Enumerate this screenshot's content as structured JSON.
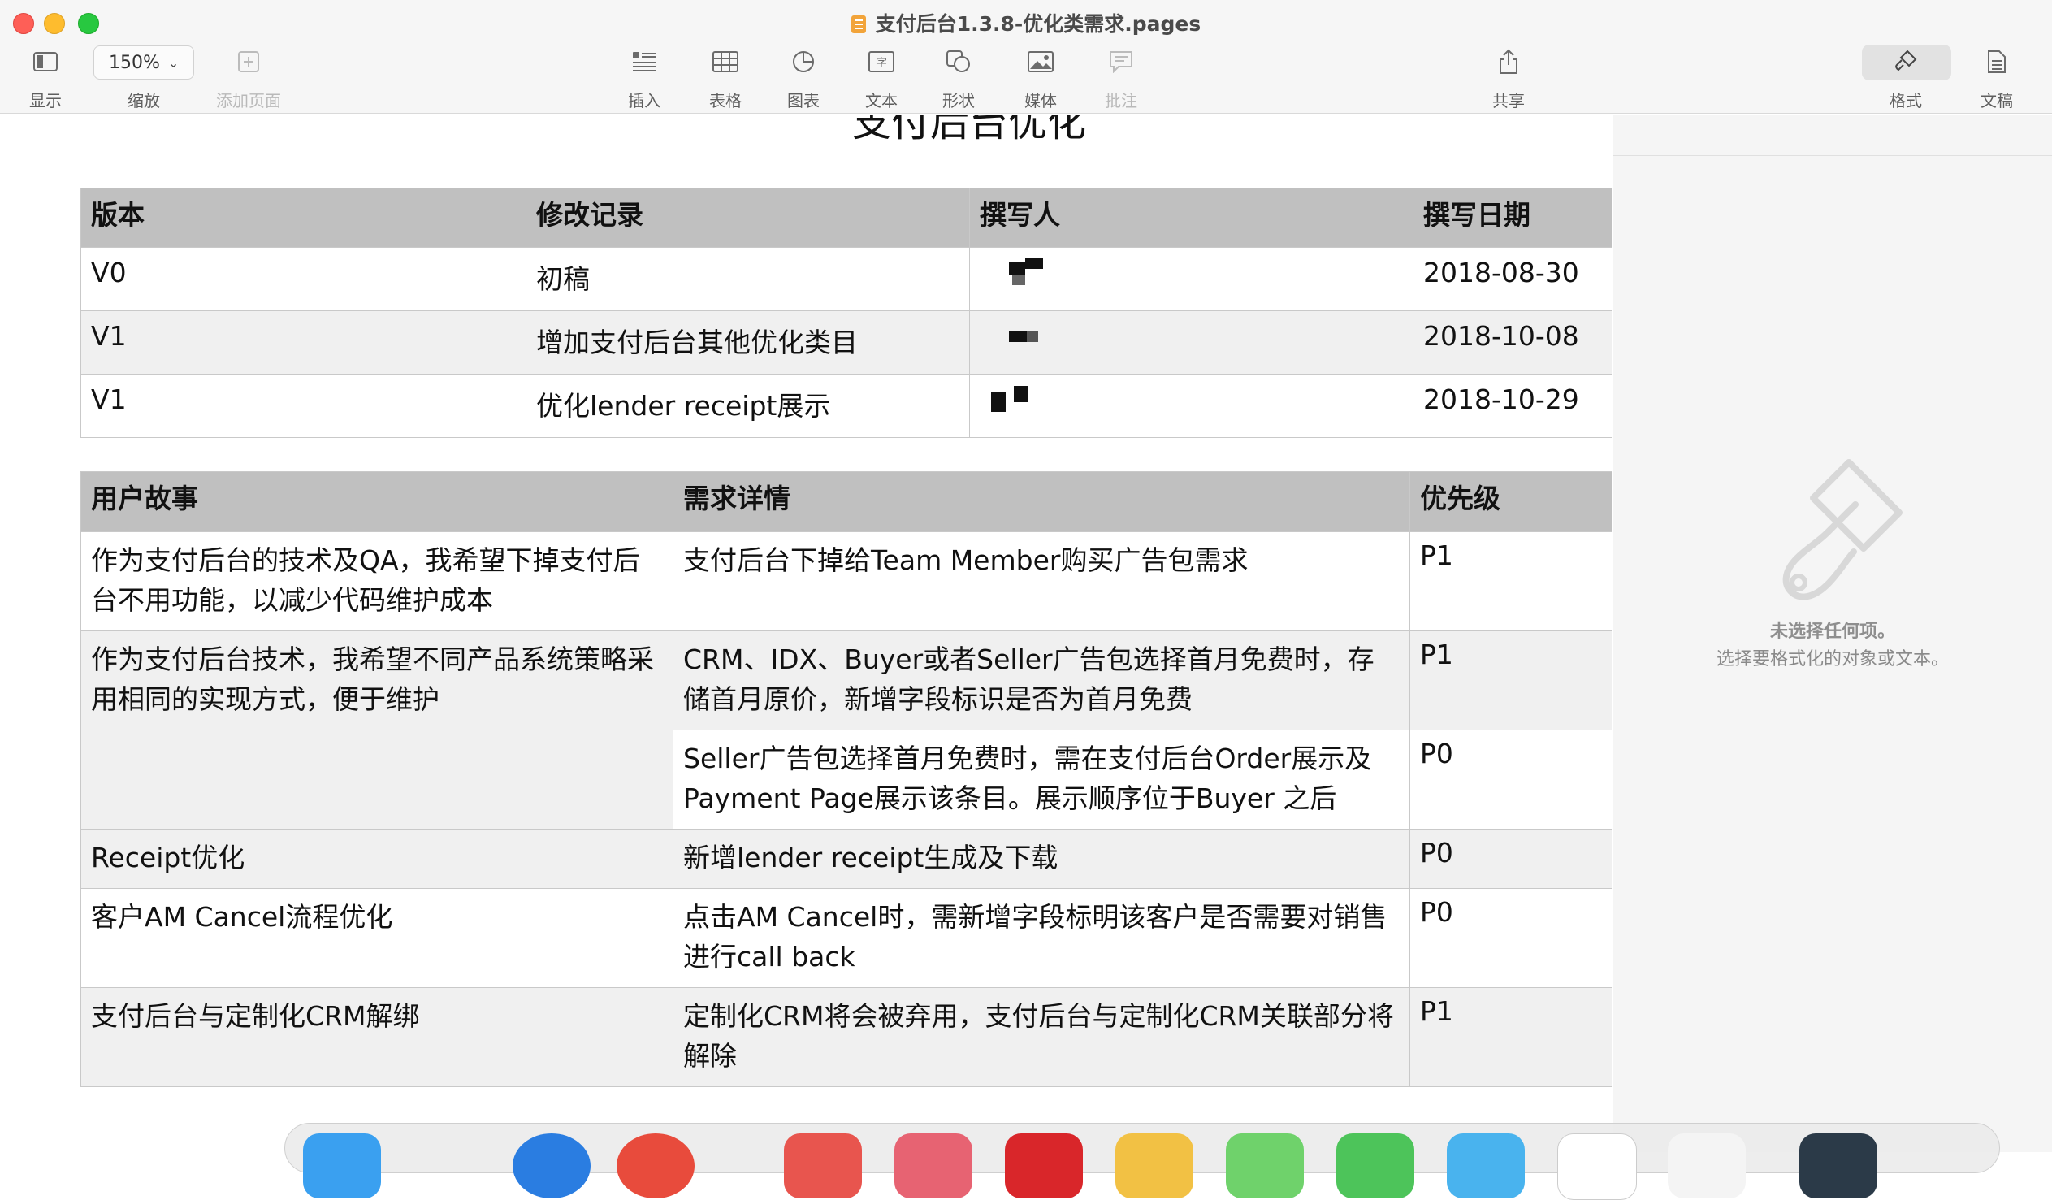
{
  "window": {
    "title": "支付后台1.3.8-优化类需求.pages"
  },
  "toolbar": {
    "view_label": "显示",
    "zoom_value": "150%",
    "zoom_label": "缩放",
    "add_page_label": "添加页面",
    "insert_label": "插入",
    "table_label": "表格",
    "chart_label": "图表",
    "text_label": "文本",
    "shape_label": "形状",
    "media_label": "媒体",
    "comment_label": "批注",
    "share_label": "共享",
    "format_label": "格式",
    "document_label": "文稿"
  },
  "document": {
    "title": "支付后台优化",
    "revision_table": {
      "headers": [
        "版本",
        "修改记录",
        "撰写人",
        "撰写日期"
      ],
      "rows": [
        {
          "version": "V0",
          "change": "初稿",
          "date": "2018-08-30"
        },
        {
          "version": "V1",
          "change": "增加支付后台其他优化类目",
          "date": "2018-10-08"
        },
        {
          "version": "V1",
          "change": "优化lender receipt展示",
          "date": "2018-10-29"
        }
      ]
    },
    "story_table": {
      "headers": [
        "用户故事",
        "需求详情",
        "优先级"
      ],
      "rows": [
        {
          "story": "作为支付后台的技术及QA，我希望下掉支付后台不用功能，以减少代码维护成本",
          "detail": "支付后台下掉给Team Member购买广告包需求",
          "priority": "P1"
        },
        {
          "story": "作为支付后台技术，我希望不同产品系统策略采用相同的实现方式，便于维护",
          "detail": "CRM、IDX、Buyer或者Seller广告包选择首月免费时，存储首月原价，新增字段标识是否为首月免费",
          "priority": "P1"
        },
        {
          "detail": "Seller广告包选择首月免费时，需在支付后台Order展示及Payment Page展示该条目。展示顺序位于Buyer 之后",
          "priority": "P0"
        },
        {
          "story": "Receipt优化",
          "detail": "新增lender receipt生成及下载",
          "priority": "P0"
        },
        {
          "story": "客户AM Cancel流程优化",
          "detail": "点击AM Cancel时，需新增字段标明该客户是否需要对销售进行call back",
          "priority": "P0"
        },
        {
          "story": "支付后台与定制化CRM解绑",
          "detail": "定制化CRM将会被弃用，支付后台与定制化CRM关联部分将解除",
          "priority": "P1"
        }
      ]
    }
  },
  "sidebar": {
    "empty_title": "未选择任何项。",
    "empty_hint": "选择要格式化的对象或文本。"
  }
}
